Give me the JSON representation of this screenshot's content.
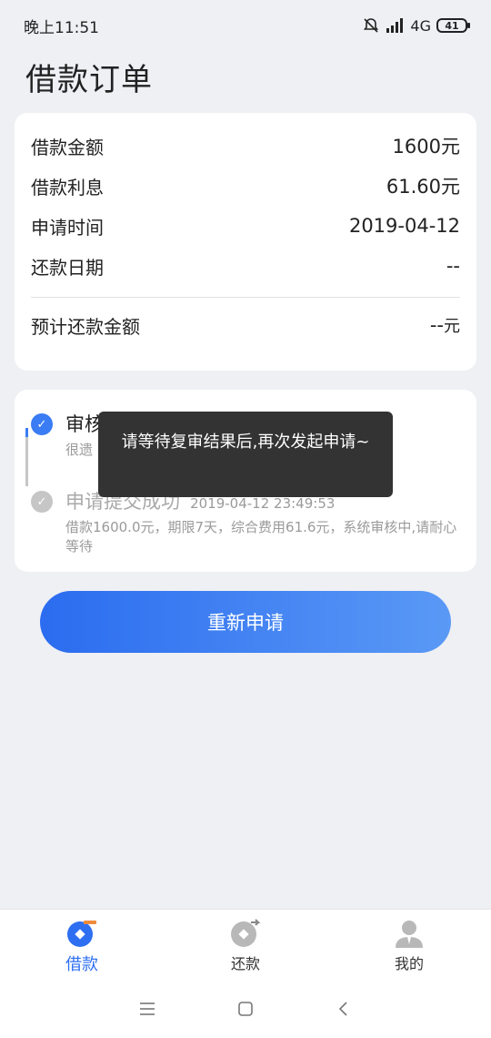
{
  "status": {
    "time": "晚上11:51",
    "network": "4G",
    "battery": "41"
  },
  "page": {
    "title": "借款订单"
  },
  "summary": {
    "rows": [
      {
        "label": "借款金额",
        "value": "1600元"
      },
      {
        "label": "借款利息",
        "value": "61.60元"
      },
      {
        "label": "申请时间",
        "value": "2019-04-12"
      },
      {
        "label": "还款日期",
        "value": "--"
      }
    ],
    "total": {
      "label": "预计还款金额",
      "value": "--",
      "unit": "元"
    }
  },
  "timeline": {
    "items": [
      {
        "title": "审核",
        "desc": "很遗"
      },
      {
        "title": "申请提交成功",
        "time": "2019-04-12 23:49:53",
        "desc": "借款1600.0元，期限7天，综合费用61.6元，系统审核中,请耐心等待"
      }
    ]
  },
  "toast": {
    "message": "请等待复审结果后,再次发起申请~"
  },
  "actions": {
    "reapply_label": "重新申请"
  },
  "tabs": [
    {
      "label": "借款",
      "icon": "loan-icon",
      "active": true
    },
    {
      "label": "还款",
      "icon": "repay-icon",
      "active": false
    },
    {
      "label": "我的",
      "icon": "user-icon",
      "active": false
    }
  ],
  "colors": {
    "accent": "#2e6ff1",
    "button_start": "#2b6cf0",
    "button_end": "#5a99f5",
    "background": "#eef0f4"
  }
}
